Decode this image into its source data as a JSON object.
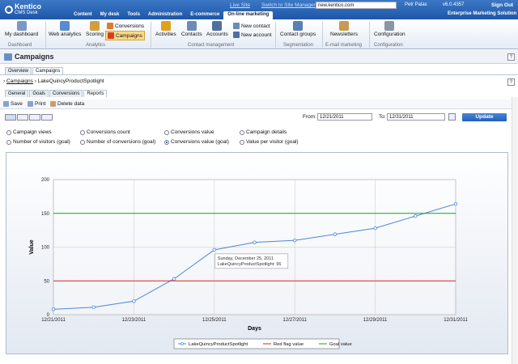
{
  "header": {
    "logo_main": "Kentico",
    "logo_sub": "CMS Desk",
    "links": [
      "Live Site",
      "Switch to Site Manager"
    ],
    "site": "new.kentico.com",
    "user": "Petr Palas",
    "version": "v6.0.4357",
    "signout": "Sign Out",
    "product": "Enterprise Marketing Solution",
    "tabs": [
      "Content",
      "My desk",
      "Tools",
      "Administration",
      "E-commerce",
      "On-line marketing"
    ],
    "active_tab": "On-line marketing"
  },
  "ribbon": {
    "my_dashboard": "My dashboard",
    "web_analytics": "Web analytics",
    "scoring": "Scoring",
    "conversions": "Conversions",
    "campaigns": "Campaigns",
    "activities": "Activities",
    "contacts": "Contacts",
    "accounts": "Accounts",
    "new_contact": "New contact",
    "new_account": "New account",
    "contact_groups": "Contact groups",
    "newsletters": "Newsletters",
    "configuration": "Configuration",
    "groups": [
      "Dashboard",
      "Analytics",
      "Contact management",
      "Segmentation",
      "E-mail marketing",
      "Configuration"
    ]
  },
  "page": {
    "title": "Campaigns",
    "help": "?",
    "tabs": [
      "Overview",
      "Campaigns"
    ],
    "breadcrumb_link": "Campaigns",
    "breadcrumb_current": "LakeQuincyProductSpotlight",
    "subtabs": [
      "General",
      "Goals",
      "Conversions",
      "Reports"
    ]
  },
  "toolbar": {
    "save": "Save",
    "print": "Print",
    "delete": "Delete data"
  },
  "filter": {
    "from_label": "From:",
    "from": "12/21/2011",
    "to_label": "To:",
    "to": "12/31/2011",
    "update": "Update"
  },
  "options": {
    "col1": [
      "Campaign views",
      "Number of visitors (goal)"
    ],
    "col2": [
      "Conversions count",
      "Number of conversions (goal)"
    ],
    "col3": [
      "Conversions value",
      "Conversions value (goal)"
    ],
    "col4": [
      "Campaign details",
      "Value per visitor (goal)"
    ],
    "selected": "Conversions value (goal)"
  },
  "chart_data": {
    "type": "line",
    "x": [
      "12/21/2011",
      "12/22/2011",
      "12/23/2011",
      "12/24/2011",
      "12/25/2011",
      "12/26/2011",
      "12/27/2011",
      "12/28/2011",
      "12/29/2011",
      "12/30/2011",
      "12/31/2011"
    ],
    "tick_labels": [
      "12/21/2011",
      "12/23/2011",
      "12/25/2011",
      "12/27/2011",
      "12/29/2011",
      "12/31/2011"
    ],
    "series": [
      {
        "name": "LakeQuincyProductSpotlight",
        "values": [
          8,
          11,
          20,
          53,
          96,
          107,
          110,
          119,
          128,
          146,
          164
        ],
        "color": "#4a86d8"
      },
      {
        "name": "Red flag value",
        "values": [
          50,
          50,
          50,
          50,
          50,
          50,
          50,
          50,
          50,
          50,
          50
        ],
        "color": "#e02020"
      },
      {
        "name": "Goal value",
        "values": [
          150,
          150,
          150,
          150,
          150,
          150,
          150,
          150,
          150,
          150,
          150
        ],
        "color": "#18a018"
      }
    ],
    "xlabel": "Days",
    "ylabel": "Value",
    "ylim": [
      0,
      200
    ],
    "yticks": [
      0,
      50,
      100,
      150,
      200
    ],
    "tooltip": {
      "date": "Sunday, December 25, 2011",
      "text": "LakeQuincyProductSpotlight: 96"
    },
    "legend_position": "bottom"
  },
  "colors": {
    "topbar": "#2a63b4",
    "accent": "#2060b8"
  }
}
